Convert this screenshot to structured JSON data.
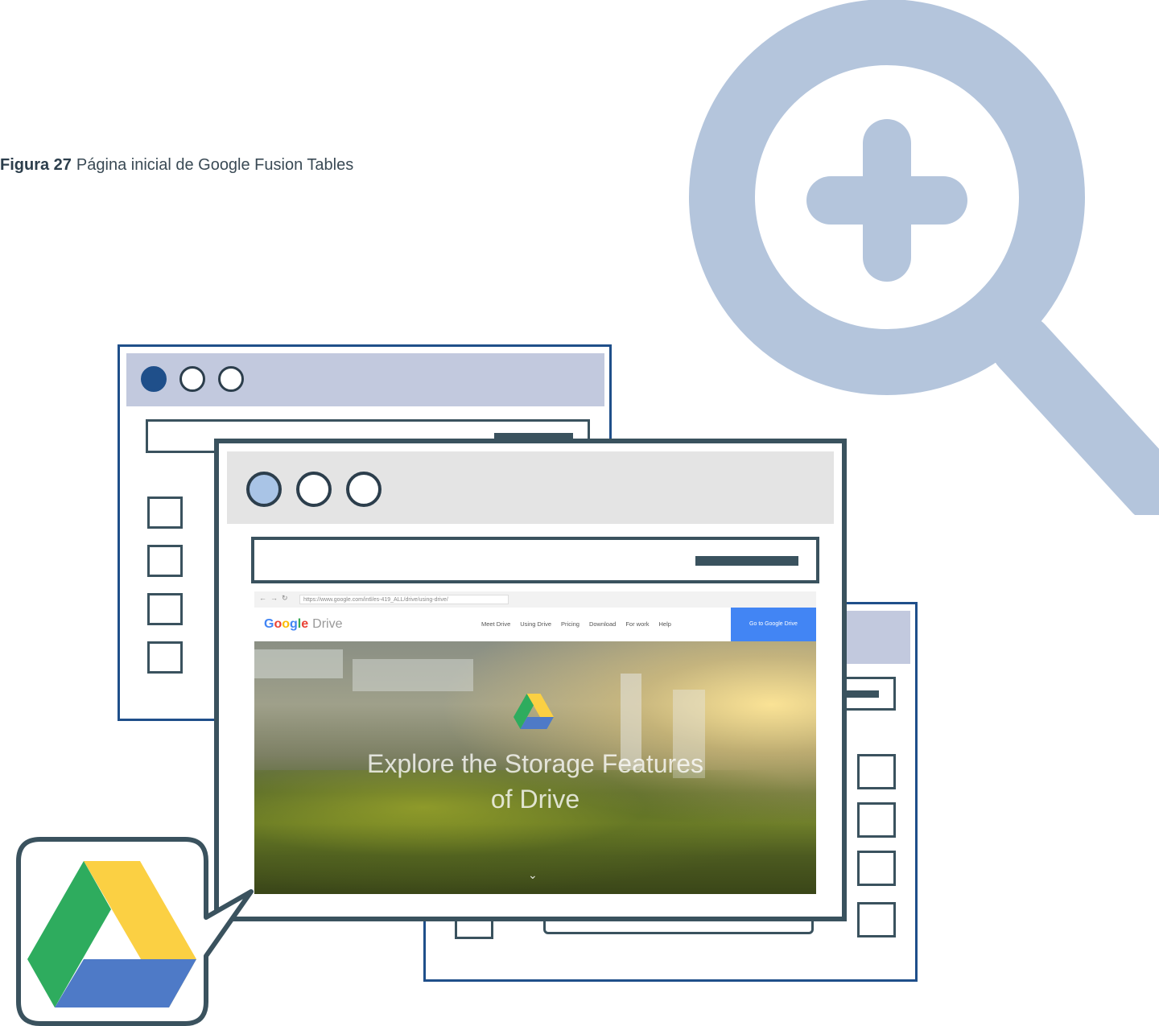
{
  "caption": {
    "label": "Figura 27",
    "text": "Página inicial de Google Fusion Tables"
  },
  "screenshot": {
    "address": "https://www.google.com/intl/es-419_ALL/drive/using-drive/",
    "logo_letters": [
      "G",
      "o",
      "o",
      "g",
      "l",
      "e"
    ],
    "logo_suffix": "Drive",
    "nav_links": [
      "Meet Drive",
      "Using Drive",
      "Pricing",
      "Download",
      "For work",
      "Help"
    ],
    "cta_label": "Go to Google Drive",
    "hero_line1": "Explore the Storage Features",
    "hero_line2": "of Drive",
    "scroll_glyph": "⌄"
  },
  "colors": {
    "magnifier": "#b4c5dc",
    "frame_blue": "#1f4f8a",
    "frame_slate": "#3a525e",
    "titlebar_lavender": "#c2c9de",
    "titlebar_grey": "#e4e4e4",
    "drive_green": "#2eac5e",
    "drive_yellow": "#fbd043",
    "drive_blue": "#4e7ac7"
  },
  "icons": [
    "magnifier-zoom-in-icon",
    "google-drive-icon",
    "window-control-dot-icon",
    "chevron-down-icon"
  ]
}
